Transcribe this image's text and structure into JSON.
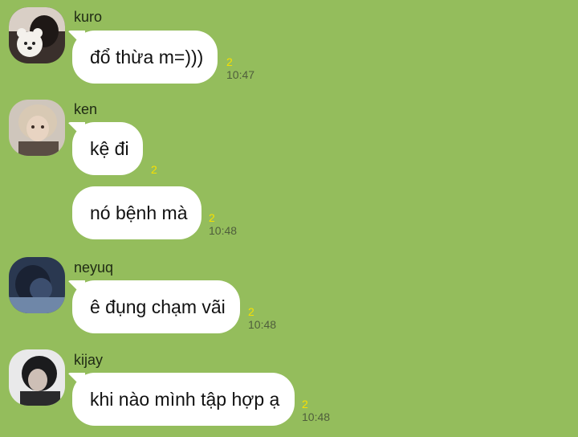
{
  "messages": [
    {
      "sender": "kuro",
      "bubbles": [
        {
          "text": "đổ thừa m=)))",
          "read": "2",
          "time": "10:47"
        }
      ]
    },
    {
      "sender": "ken",
      "bubbles": [
        {
          "text": "kệ đi",
          "read": "2",
          "time": ""
        },
        {
          "text": "nó bệnh mà",
          "read": "2",
          "time": "10:48"
        }
      ]
    },
    {
      "sender": "neyuq",
      "bubbles": [
        {
          "text": "ê đụng chạm vãi",
          "read": "2",
          "time": "10:48"
        }
      ]
    },
    {
      "sender": "kijay",
      "bubbles": [
        {
          "text": "khi nào mình tập hợp ạ",
          "read": "2",
          "time": "10:48"
        }
      ]
    }
  ],
  "colors": {
    "background": "#94bd5c",
    "bubble": "#ffffff",
    "read_count": "#f7e000",
    "timestamp": "#4f5e3c"
  }
}
